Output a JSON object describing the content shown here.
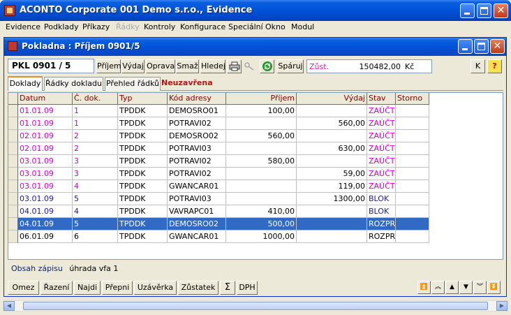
{
  "window": {
    "title": "ACONTO Corporate 001 Demo s.r.o., Evidence"
  },
  "menu": [
    {
      "label": "Evidence",
      "disabled": false
    },
    {
      "label": "Podklady",
      "disabled": false
    },
    {
      "label": "Příkazy",
      "disabled": false
    },
    {
      "label": "Řádky",
      "disabled": true
    },
    {
      "label": "Kontroly",
      "disabled": false
    },
    {
      "label": "Konfigurace",
      "disabled": false
    },
    {
      "label": "Speciální",
      "disabled": false
    },
    {
      "label": "Okno",
      "disabled": false
    },
    {
      "label": "Modul",
      "disabled": false
    }
  ],
  "doc_window": {
    "title": "Pokladna : Příjem 0901/5",
    "doc_number": "PKL 0901 / 5",
    "toolbar": {
      "prijem": "Příjem",
      "vydaj": "Výdaj",
      "oprava": "Oprava",
      "smaz": "Smaž",
      "hledej": "Hledej",
      "sparuj": "Spáruj",
      "k": "K",
      "help": "?"
    },
    "balance": {
      "label": "Zůst.",
      "value": "150482,00",
      "currency": "Kč"
    },
    "tabs": [
      "Doklady",
      "Řádky dokladu",
      "Přehled řádků"
    ],
    "status": "Neuzavřena",
    "columns": [
      "Datum",
      "Č. dok.",
      "Typ",
      "Kód adresy",
      "Příjem",
      "Výdaj",
      "Stav",
      "Storno"
    ],
    "rows": [
      {
        "datum": "01.01.09",
        "cdok": "1",
        "typ": "TPDDK",
        "kod": "DEMOSRO01",
        "prijem": "100,00",
        "vydaj": "",
        "stav": "ZAÚČT",
        "storno": "",
        "color": "#d000c8"
      },
      {
        "datum": "01.01.09",
        "cdok": "1",
        "typ": "TPDDK",
        "kod": "POTRAVI02",
        "prijem": "",
        "vydaj": "560,00",
        "stav": "ZAÚČT",
        "storno": "",
        "color": "#d000c8"
      },
      {
        "datum": "02.01.09",
        "cdok": "2",
        "typ": "TPDDK",
        "kod": "DEMOSRO02",
        "prijem": "560,00",
        "vydaj": "",
        "stav": "ZAÚČT",
        "storno": "",
        "color": "#d000c8"
      },
      {
        "datum": "02.01.09",
        "cdok": "2",
        "typ": "TPDDK",
        "kod": "POTRAVI03",
        "prijem": "",
        "vydaj": "630,00",
        "stav": "ZAÚČT",
        "storno": "",
        "color": "#d000c8"
      },
      {
        "datum": "03.01.09",
        "cdok": "3",
        "typ": "TPDDK",
        "kod": "POTRAVI02",
        "prijem": "580,00",
        "vydaj": "",
        "stav": "ZAÚČT",
        "storno": "",
        "color": "#d000c8"
      },
      {
        "datum": "03.01.09",
        "cdok": "3",
        "typ": "TPDDK",
        "kod": "POTRAVI02",
        "prijem": "",
        "vydaj": "59,00",
        "stav": "ZAÚČT",
        "storno": "",
        "color": "#d000c8"
      },
      {
        "datum": "03.01.09",
        "cdok": "4",
        "typ": "TPDDK",
        "kod": "GWANCAR01",
        "prijem": "",
        "vydaj": "119,00",
        "stav": "ZAÚČT",
        "storno": "",
        "color": "#d000c8"
      },
      {
        "datum": "03.01.09",
        "cdok": "5",
        "typ": "TPDDK",
        "kod": "POTRAVI03",
        "prijem": "",
        "vydaj": "1300,00",
        "stav": "BLOK",
        "storno": "",
        "color": "#1a1aa0"
      },
      {
        "datum": "04.01.09",
        "cdok": "4",
        "typ": "TPDDK",
        "kod": "VAVRAPC01",
        "prijem": "410,00",
        "vydaj": "",
        "stav": "BLOK",
        "storno": "",
        "color": "#1a1aa0"
      },
      {
        "datum": "04.01.09",
        "cdok": "5",
        "typ": "TPDDK",
        "kod": "DEMOSRO02",
        "prijem": "500,00",
        "vydaj": "",
        "stav": "ROZPR",
        "storno": "",
        "color": "#000000",
        "selected": true
      },
      {
        "datum": "06.01.09",
        "cdok": "6",
        "typ": "TPDDK",
        "kod": "GWANCAR01",
        "prijem": "1000,00",
        "vydaj": "",
        "stav": "ROZPR",
        "storno": "",
        "color": "#000000"
      }
    ],
    "memo": {
      "label": "Obsah zápisu",
      "value": "úhrada vfa 1"
    },
    "bottom_buttons": [
      "Omez",
      "Řazení",
      "Najdi",
      "Přepni",
      "Uzávěrka",
      "Zůstatek",
      "Σ",
      "DPH"
    ]
  },
  "colors": {
    "title_bar": "#0052d8",
    "header_text": "#800000",
    "selection": "#316ac5",
    "posted": "#d000c8",
    "blocked": "#1a1aa0",
    "status_text": "#b01414"
  }
}
